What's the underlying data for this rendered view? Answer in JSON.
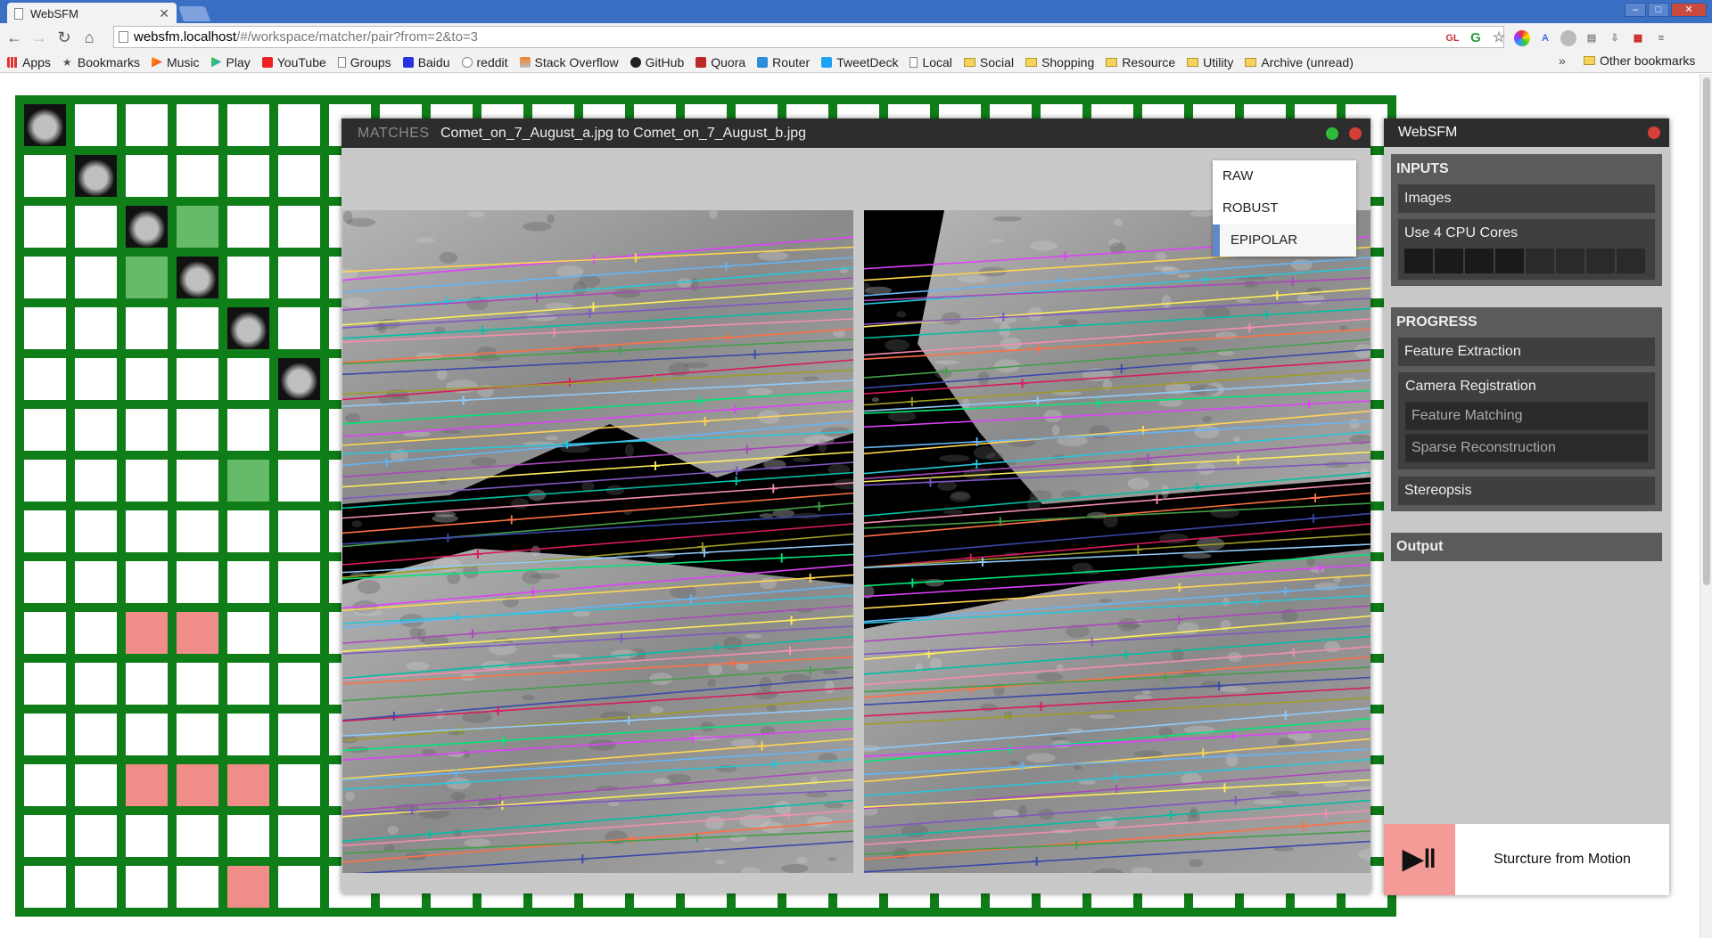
{
  "browser": {
    "tab_title": "WebSFM",
    "url_host": "websfm.localhost",
    "url_path": "/#/workspace/matcher/pair?from=2&to=3",
    "bookmarks": [
      "Apps",
      "Bookmarks",
      "Music",
      "Play",
      "YouTube",
      "Groups",
      "Baidu",
      "reddit",
      "Stack Overflow",
      "GitHub",
      "Quora",
      "Router",
      "TweetDeck",
      "Local",
      "Social",
      "Shopping",
      "Resource",
      "Utility",
      "Archive (unread)"
    ],
    "bookmark_chevron": "»",
    "other_bookmarks": "Other bookmarks",
    "ext_gl": "GL"
  },
  "matches": {
    "label": "MATCHES",
    "title": "Comet_on_7_August_a.jpg to Comet_on_7_August_b.jpg",
    "modes": [
      "RAW",
      "ROBUST",
      "EPIPOLAR"
    ],
    "selected_mode": "EPIPOLAR"
  },
  "sfm": {
    "title": "WebSFM",
    "inputs_title": "INPUTS",
    "images_label": "Images",
    "cores_label": "Use 4 CPU Cores",
    "cores_selected": 4,
    "cores_total": 8,
    "progress_title": "PROGRESS",
    "feature_extraction": "Feature Extraction",
    "camera_registration": "Camera Registration",
    "feature_matching": "Feature Matching",
    "sparse_reconstruction": "Sparse Reconstruction",
    "stereopsis": "Stereopsis",
    "output": "Output",
    "play_label": "Sturcture from Motion"
  },
  "colors": {
    "grid_green": "#0f7d18",
    "match_green": "#66bb6a",
    "match_red": "#f08d88",
    "panel_dark": "#2d2d2d",
    "play_pink": "#f49b97",
    "close_red": "#d44035",
    "ok_green": "#2fbb3a",
    "select_blue": "#5e89c6"
  }
}
